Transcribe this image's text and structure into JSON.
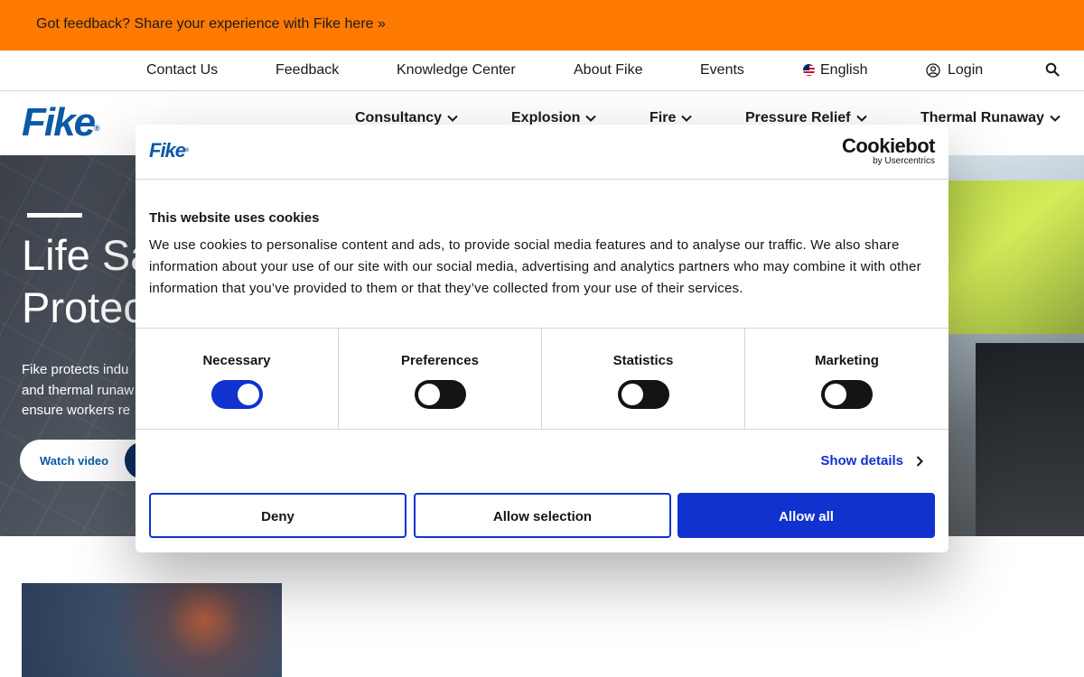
{
  "banner": {
    "text": "Got feedback? Share your experience with Fike here »"
  },
  "utility_nav": {
    "contact": "Contact Us",
    "feedback": "Feedback",
    "knowledge": "Knowledge Center",
    "about": "About Fike",
    "events": "Events",
    "language": "English",
    "login": "Login"
  },
  "brand": {
    "logo": "Fike",
    "registered": "®"
  },
  "main_nav": {
    "consultancy": "Consultancy",
    "explosion": "Explosion",
    "fire": "Fire",
    "pressure": "Pressure Relief",
    "thermal": "Thermal Runaway"
  },
  "hero": {
    "title_line1": "Life Sa",
    "title_line2": "Protec",
    "body_line1": "Fike protects indu",
    "body_line2": "and thermal runaw",
    "body_line3": "ensure workers re",
    "watch_label": "Watch video"
  },
  "cookie_dialog": {
    "logo": "Fike",
    "registered": "®",
    "brand_name": "Cookiebot",
    "brand_sub": "by Usercentrics",
    "title": "This website uses cookies",
    "text": "We use cookies to personalise content and ads, to provide social media features and to analyse our traffic. We also share information about your use of our site with our social media, advertising and analytics partners who may combine it with other information that you’ve provided to them or that they’ve collected from your use of their services.",
    "categories": [
      {
        "label": "Necessary",
        "enabled": true
      },
      {
        "label": "Preferences",
        "enabled": false
      },
      {
        "label": "Statistics",
        "enabled": false
      },
      {
        "label": "Marketing",
        "enabled": false
      }
    ],
    "show_details": "Show details",
    "deny": "Deny",
    "allow_selection": "Allow selection",
    "allow_all": "Allow all"
  },
  "colors": {
    "banner": "#ff7a00",
    "brand_blue": "#0b5aa5",
    "cookiebot_blue": "#1032cf",
    "toggle_off": "#141414"
  },
  "icons": [
    "flag-us-icon",
    "user-circle-icon",
    "search-icon",
    "chevron-down-icon",
    "chevron-right-icon",
    "play-icon"
  ]
}
